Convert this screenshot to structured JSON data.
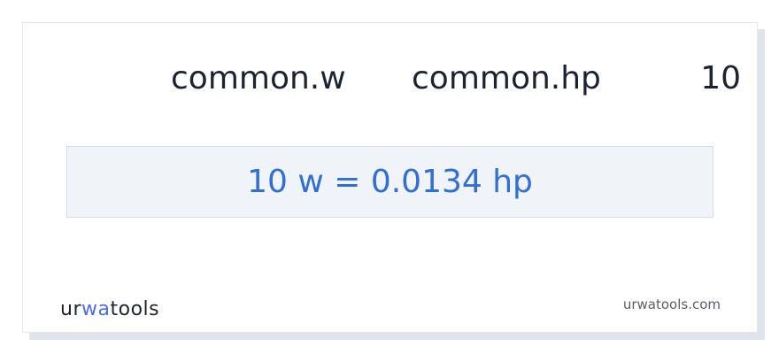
{
  "converter": {
    "from_unit": "common.w",
    "to_unit": "common.hp",
    "amount": "10",
    "result": "10 w = 0.0134 hp"
  },
  "footer": {
    "logo_text": "urwatools",
    "logo_parts": [
      "ur",
      "wa",
      "tools"
    ],
    "site_url": "urwatools.com"
  },
  "colors": {
    "result_text": "#2f6fd6",
    "logo_accent": "#4a6fe0",
    "result_bg": "#f0f4f8"
  }
}
